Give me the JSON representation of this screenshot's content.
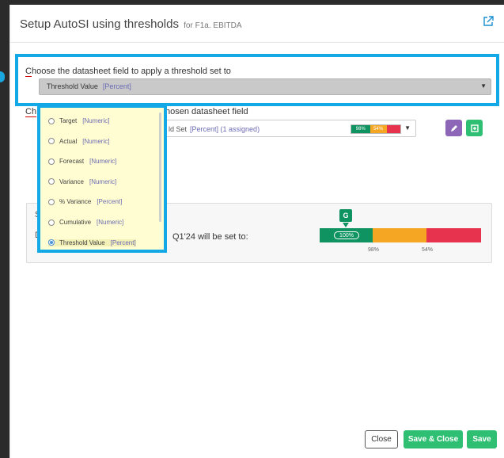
{
  "header": {
    "title": "Setup AutoSI using thresholds",
    "subtitle": "for F1a. EBITDA",
    "popout_icon": "external-link-icon"
  },
  "field_select": {
    "label_first_char": "C",
    "label_rest": "hoose the datasheet field to apply a threshold set to",
    "value": "Threshold Value",
    "value_type": "[Percent]"
  },
  "threshold_section": {
    "label_start": "Ch",
    "label_end": "hosen datasheet field",
    "select_value": "ld Set",
    "select_meta": "[Percent] (1 assigned)",
    "mini_bar": [
      {
        "label": "98%",
        "color": "#0f9461",
        "fraction": 0.38
      },
      {
        "label": "54%",
        "color": "#f5a623",
        "fraction": 0.34
      },
      {
        "label": "",
        "color": "#e8334f",
        "fraction": 0.28
      }
    ],
    "edit_icon": "pencil-icon",
    "add_icon": "plus-square-icon"
  },
  "preview_panel": {
    "letter_1": "S",
    "letter_2": "D",
    "text": "Q1'24 will be set to:",
    "badge": "G",
    "bar": [
      {
        "color": "#0f9461",
        "fraction": 0.33
      },
      {
        "color": "#f5a623",
        "fraction": 0.33
      },
      {
        "color": "#e8334f",
        "fraction": 0.34
      }
    ],
    "current_value": "100%",
    "tick_labels": [
      "98%",
      "54%"
    ]
  },
  "dropdown": {
    "options": [
      {
        "label": "Target",
        "type": "[Numeric]",
        "selected": false
      },
      {
        "label": "Actual",
        "type": "[Numeric]",
        "selected": false
      },
      {
        "label": "Forecast",
        "type": "[Numeric]",
        "selected": false
      },
      {
        "label": "Variance",
        "type": "[Numeric]",
        "selected": false
      },
      {
        "label": "% Variance",
        "type": "[Percent]",
        "selected": false
      },
      {
        "label": "Cumulative",
        "type": "[Numeric]",
        "selected": false
      },
      {
        "label": "Threshold Value",
        "type": "[Percent]",
        "selected": true
      }
    ]
  },
  "footer": {
    "close_label": "Close",
    "save_close_label": "Save & Close",
    "save_label": "Save"
  }
}
